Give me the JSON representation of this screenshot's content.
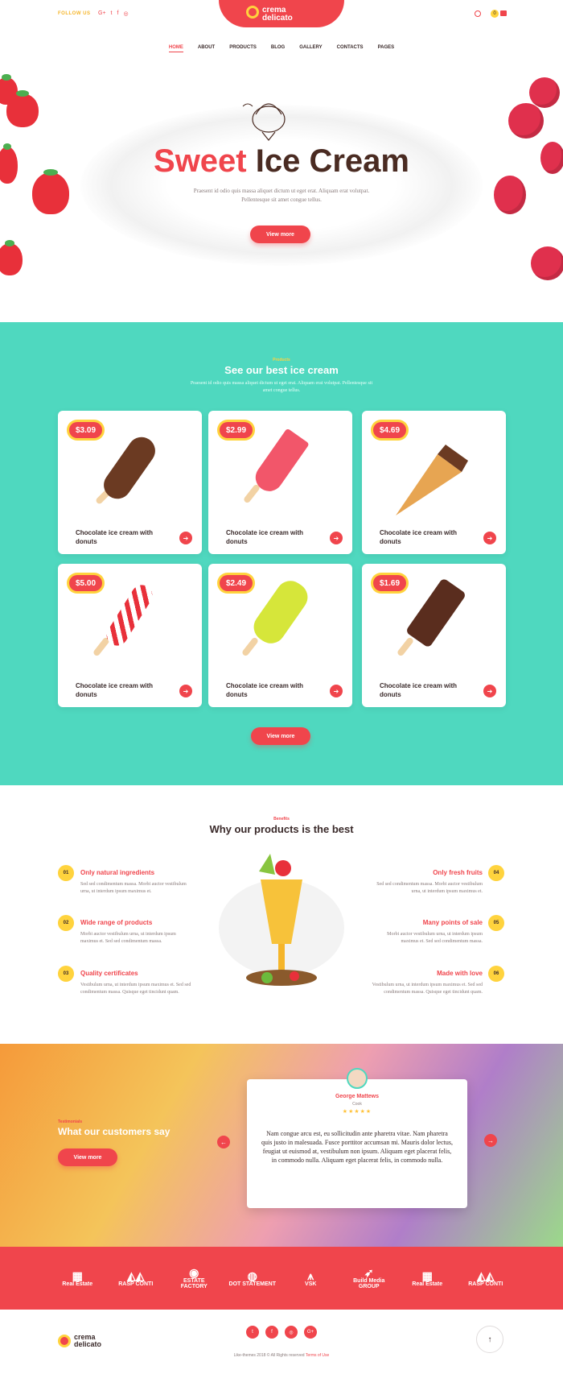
{
  "header": {
    "follow_label": "FOLLOW US",
    "social": [
      "G+",
      "t",
      "f",
      "◎"
    ],
    "logo_line1": "crema",
    "logo_line2": "delicato",
    "cart_count": "0",
    "nav": [
      "HOME",
      "ABOUT",
      "PRODUCTS",
      "BLOG",
      "GALLERY",
      "CONTACTS",
      "PAGES"
    ]
  },
  "hero": {
    "title_a": "Sweet",
    "title_b": "Ice Cream",
    "subtitle": "Praesent id odio quis massa aliquet dictum ut eget erat. Aliquam erat volutpat. Pellentesque sit amet congue tellus.",
    "button": "View more"
  },
  "products": {
    "kicker": "Products",
    "title": "See our best ice cream",
    "subtitle": "Praesent id odio quis massa aliquet dictum ut eget erat. Aliquam erat volutpat. Pellentesque sit amet congue tellus.",
    "items": [
      {
        "price": "$3.09",
        "name": "Chocolate ice cream with donuts"
      },
      {
        "price": "$2.99",
        "name": "Chocolate ice cream with donuts"
      },
      {
        "price": "$4.69",
        "name": "Chocolate ice cream with donuts"
      },
      {
        "price": "$5.00",
        "name": "Chocolate ice cream with donuts"
      },
      {
        "price": "$2.49",
        "name": "Chocolate ice cream with donuts"
      },
      {
        "price": "$1.69",
        "name": "Chocolate ice cream with donuts"
      }
    ],
    "button": "View more"
  },
  "benefits": {
    "kicker": "Benefits",
    "title": "Why our products is the best",
    "left": [
      {
        "num": "01",
        "title": "Only natural ingredients",
        "text": "Sed sed condimentum massa. Morbi auctor vestibulum urna, ut interdum ipsum maximus et."
      },
      {
        "num": "02",
        "title": "Wide range of products",
        "text": "Morbi auctor vestibulum urna, ut interdum ipsum maximus et. Sed sed condimentum massa."
      },
      {
        "num": "03",
        "title": "Quality certificates",
        "text": "Vestibulum urna, ut interdum ipsum maximus et. Sed sed condimentum massa. Quisque eget tincidunt quam."
      }
    ],
    "right": [
      {
        "num": "04",
        "title": "Only fresh fruits",
        "text": "Sed sed condimentum massa. Morbi auctor vestibulum urna, ut interdum ipsum maximus et."
      },
      {
        "num": "05",
        "title": "Many points of sale",
        "text": "Morbi auctor vestibulum urna, ut interdum ipsum maximus et. Sed sed condimentum massa."
      },
      {
        "num": "06",
        "title": "Made with love",
        "text": "Vestibulum urna, ut interdum ipsum maximus et. Sed sed condimentum massa. Quisque eget tincidunt quam."
      }
    ]
  },
  "testimonials": {
    "kicker": "Testimonials",
    "title": "What our customers say",
    "button": "View more",
    "name": "George Mattews",
    "role": "Cook",
    "stars": "★★★★★",
    "quote": "Nam congue arcu est, eu sollicitudin ante pharetra vitae. Nam pharetra quis justo in malesuada. Fusce porttitor accumsan mi. Mauris dolor lectus, feugiat ut euismod at, vestibulum non ipsum. Aliquam eget placerat felis, in commodo nulla. Aliquam eget placerat felis, in commodo nulla."
  },
  "partners": [
    {
      "glyph": "▦",
      "label": "Real Estate"
    },
    {
      "glyph": "◭◭",
      "label": "RASP CONTI"
    },
    {
      "glyph": "◉",
      "label": "ESTATE FACTORY"
    },
    {
      "glyph": "◍",
      "label": "DOT STATEMENT"
    },
    {
      "glyph": "⩚",
      "label": "VSK"
    },
    {
      "glyph": "➶",
      "label": "Build Media GROUP"
    },
    {
      "glyph": "▦",
      "label": "Real Estate"
    },
    {
      "glyph": "◭◭",
      "label": "RASP CONTI"
    }
  ],
  "footer": {
    "logo_line1": "crema",
    "logo_line2": "delicato",
    "social": [
      "t",
      "f",
      "◎",
      "G+"
    ],
    "copyright": "Like-themes 2018 © All Rights reserved",
    "terms": "Terms of Use",
    "up": "↑"
  },
  "colors": {
    "accent": "#f0454c",
    "mint": "#4fd8bf",
    "yellow": "#ffd33d",
    "brown": "#4a2b22"
  }
}
